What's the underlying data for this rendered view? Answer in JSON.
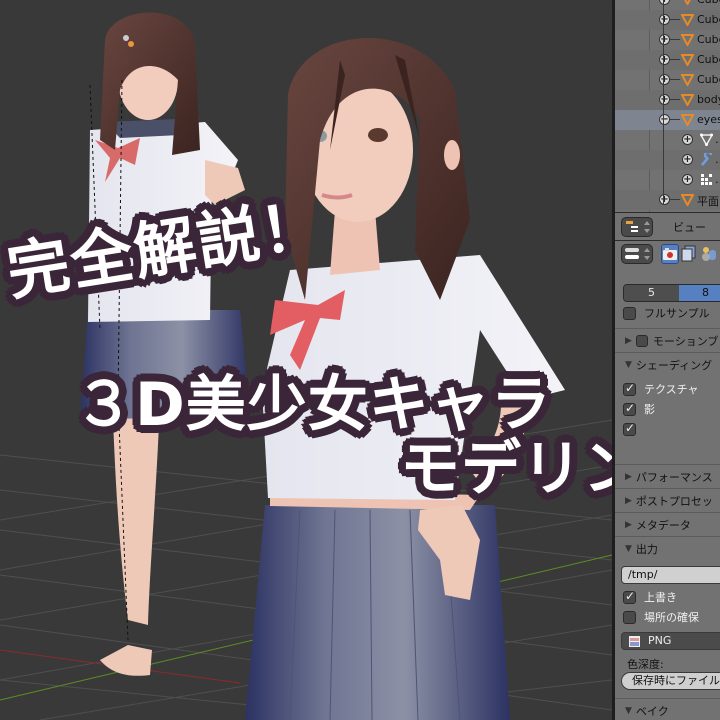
{
  "title_overlay": {
    "line1": "完全解説！",
    "line2": "３D美少女キャラ",
    "line3": "モデリング",
    "fill_color": "#ffffff",
    "outline_color": "#3a2638"
  },
  "viewport": {
    "background": "#393939",
    "grid_color": "#4f4f4f",
    "x_axis_color": "#8a2b2b",
    "y_axis_color": "#5c8f22"
  },
  "outliner": {
    "rows": [
      {
        "label": "Cube",
        "type": "mesh-object",
        "expanded": false
      },
      {
        "label": "Cube",
        "type": "mesh-object",
        "expanded": false
      },
      {
        "label": "Cube",
        "type": "mesh-object",
        "expanded": false
      },
      {
        "label": "Cube",
        "type": "mesh-object",
        "expanded": false
      },
      {
        "label": "Cube",
        "type": "mesh-object",
        "expanded": false
      },
      {
        "label": "body",
        "type": "mesh-object",
        "expanded": false
      },
      {
        "label": "eyes",
        "type": "mesh-object",
        "expanded": true,
        "selected": true
      },
      {
        "label": "…",
        "type": "mesh-data",
        "child": true
      },
      {
        "label": "…",
        "type": "modifier",
        "child": true
      },
      {
        "label": "…",
        "type": "vertex-groups",
        "child": true
      },
      {
        "label": "平面",
        "type": "mesh-object",
        "expanded": false
      }
    ]
  },
  "properties_header": {
    "view_menu": "ビュー"
  },
  "properties": {
    "segment": {
      "left": "5",
      "right": "8",
      "selected": "8"
    },
    "full_sample": {
      "label": "フルサンプル",
      "checked": false
    },
    "sections": {
      "motion_blur": "モーションブ",
      "shading": "シェーディング",
      "performance": "パフォーマンス",
      "post_processing": "ポストプロセッ",
      "metadata": "メタデータ",
      "output": "出力",
      "bake": "ベイク"
    },
    "shading_options": [
      {
        "label": "テクスチャ",
        "checked": true
      },
      {
        "label": "影",
        "checked": true
      },
      {
        "label": "",
        "checked": true
      }
    ],
    "output": {
      "path": "/tmp/",
      "overwrite": {
        "label": "上書き",
        "checked": true
      },
      "placeholders": {
        "label": "場所の確保",
        "checked": false
      },
      "file_format": "PNG",
      "color_depth_label": "色深度:",
      "save_button": "保存時にファイル"
    },
    "accent_color": "#5680c2"
  }
}
